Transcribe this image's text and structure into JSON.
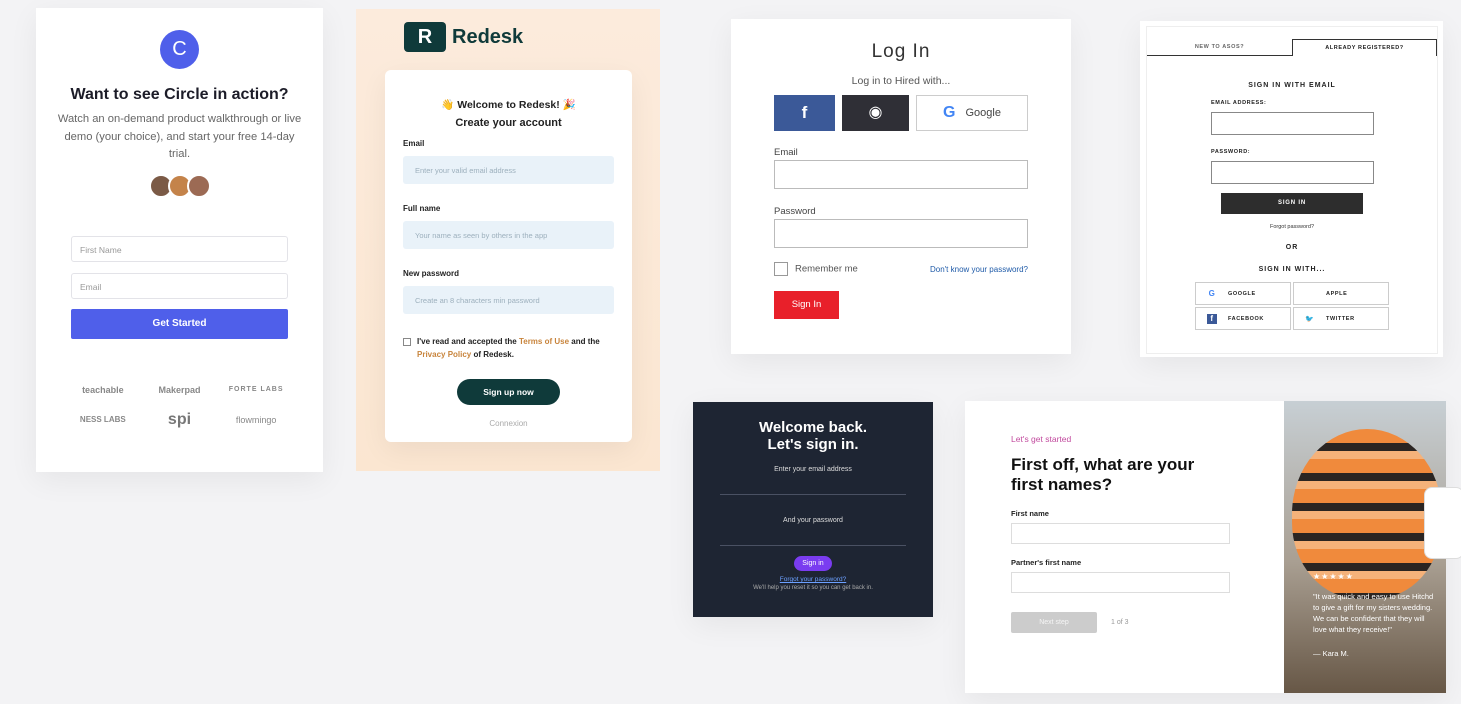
{
  "circle": {
    "logo_letter": "C",
    "title": "Want to see Circle in action?",
    "description": "Watch an on-demand product walkthrough or live demo (your choice), and start your free 14-day trial.",
    "first_name_placeholder": "First Name",
    "email_placeholder": "Email",
    "cta": "Get Started",
    "partner_logos": [
      "teachable",
      "Makerpad",
      "FORTE LABS",
      "NESS LABS",
      "spi",
      "flowmingo"
    ],
    "accent": "#4f5fea"
  },
  "redesk": {
    "brand": "Redesk",
    "logo_letter": "R",
    "welcome": "👋 Welcome to Redesk! 🎉",
    "heading": "Create your account",
    "email_label": "Email",
    "email_placeholder": "Enter your valid email address",
    "fullname_label": "Full name",
    "fullname_placeholder": "Your name as seen by others in the app",
    "password_label": "New password",
    "password_placeholder": "Create an 8 characters min password",
    "terms_prefix": "I've read and accepted the ",
    "terms_link": "Terms of Use",
    "terms_middle": " and the ",
    "privacy_link": "Privacy Policy",
    "terms_suffix": " of Redesk.",
    "submit": "Sign up now",
    "alt_link": "Connexion",
    "accent": "#0f3a3a"
  },
  "hired": {
    "title": "Log In",
    "subtitle": "Log in to Hired with...",
    "facebook_glyph": "f",
    "github_glyph": "◉",
    "google_glyph": "G",
    "google_label": "Google",
    "email_label": "Email",
    "password_label": "Password",
    "remember_label": "Remember me",
    "forgot_link": "Don't know your password?",
    "submit": "Sign In",
    "accent": "#e8202a"
  },
  "asos": {
    "tab_new": "NEW TO ASOS?",
    "tab_registered": "ALREADY REGISTERED?",
    "section_title": "SIGN IN WITH EMAIL",
    "email_label": "EMAIL ADDRESS:",
    "password_label": "PASSWORD:",
    "submit": "SIGN IN",
    "forgot": "Forgot password?",
    "or": "OR",
    "social_title": "SIGN IN WITH...",
    "socials": [
      {
        "icon": "G",
        "label": "GOOGLE"
      },
      {
        "icon": "",
        "label": "APPLE"
      },
      {
        "icon": "f",
        "label": "FACEBOOK"
      },
      {
        "icon": "🐦",
        "label": "TWITTER"
      }
    ]
  },
  "dark": {
    "title_line1": "Welcome back.",
    "title_line2": "Let's sign in.",
    "email_label": "Enter your email address",
    "password_label": "And your password",
    "submit": "Sign in",
    "forgot": "Forgot your password?",
    "help": "We'll help you reset it so you can get back in.",
    "accent": "#7a3cf0"
  },
  "hitchd": {
    "tag": "Let's get started",
    "title": "First off, what are your first names?",
    "first_label": "First name",
    "partner_label": "Partner's first name",
    "next": "Next step",
    "step": "1 of 3",
    "stars": "★★★★★",
    "quote": "\"It was quick and easy to use Hitchd to give a gift for my sisters wedding. We can be confident that they will love what they receive!\"",
    "author": "— Kara M."
  }
}
